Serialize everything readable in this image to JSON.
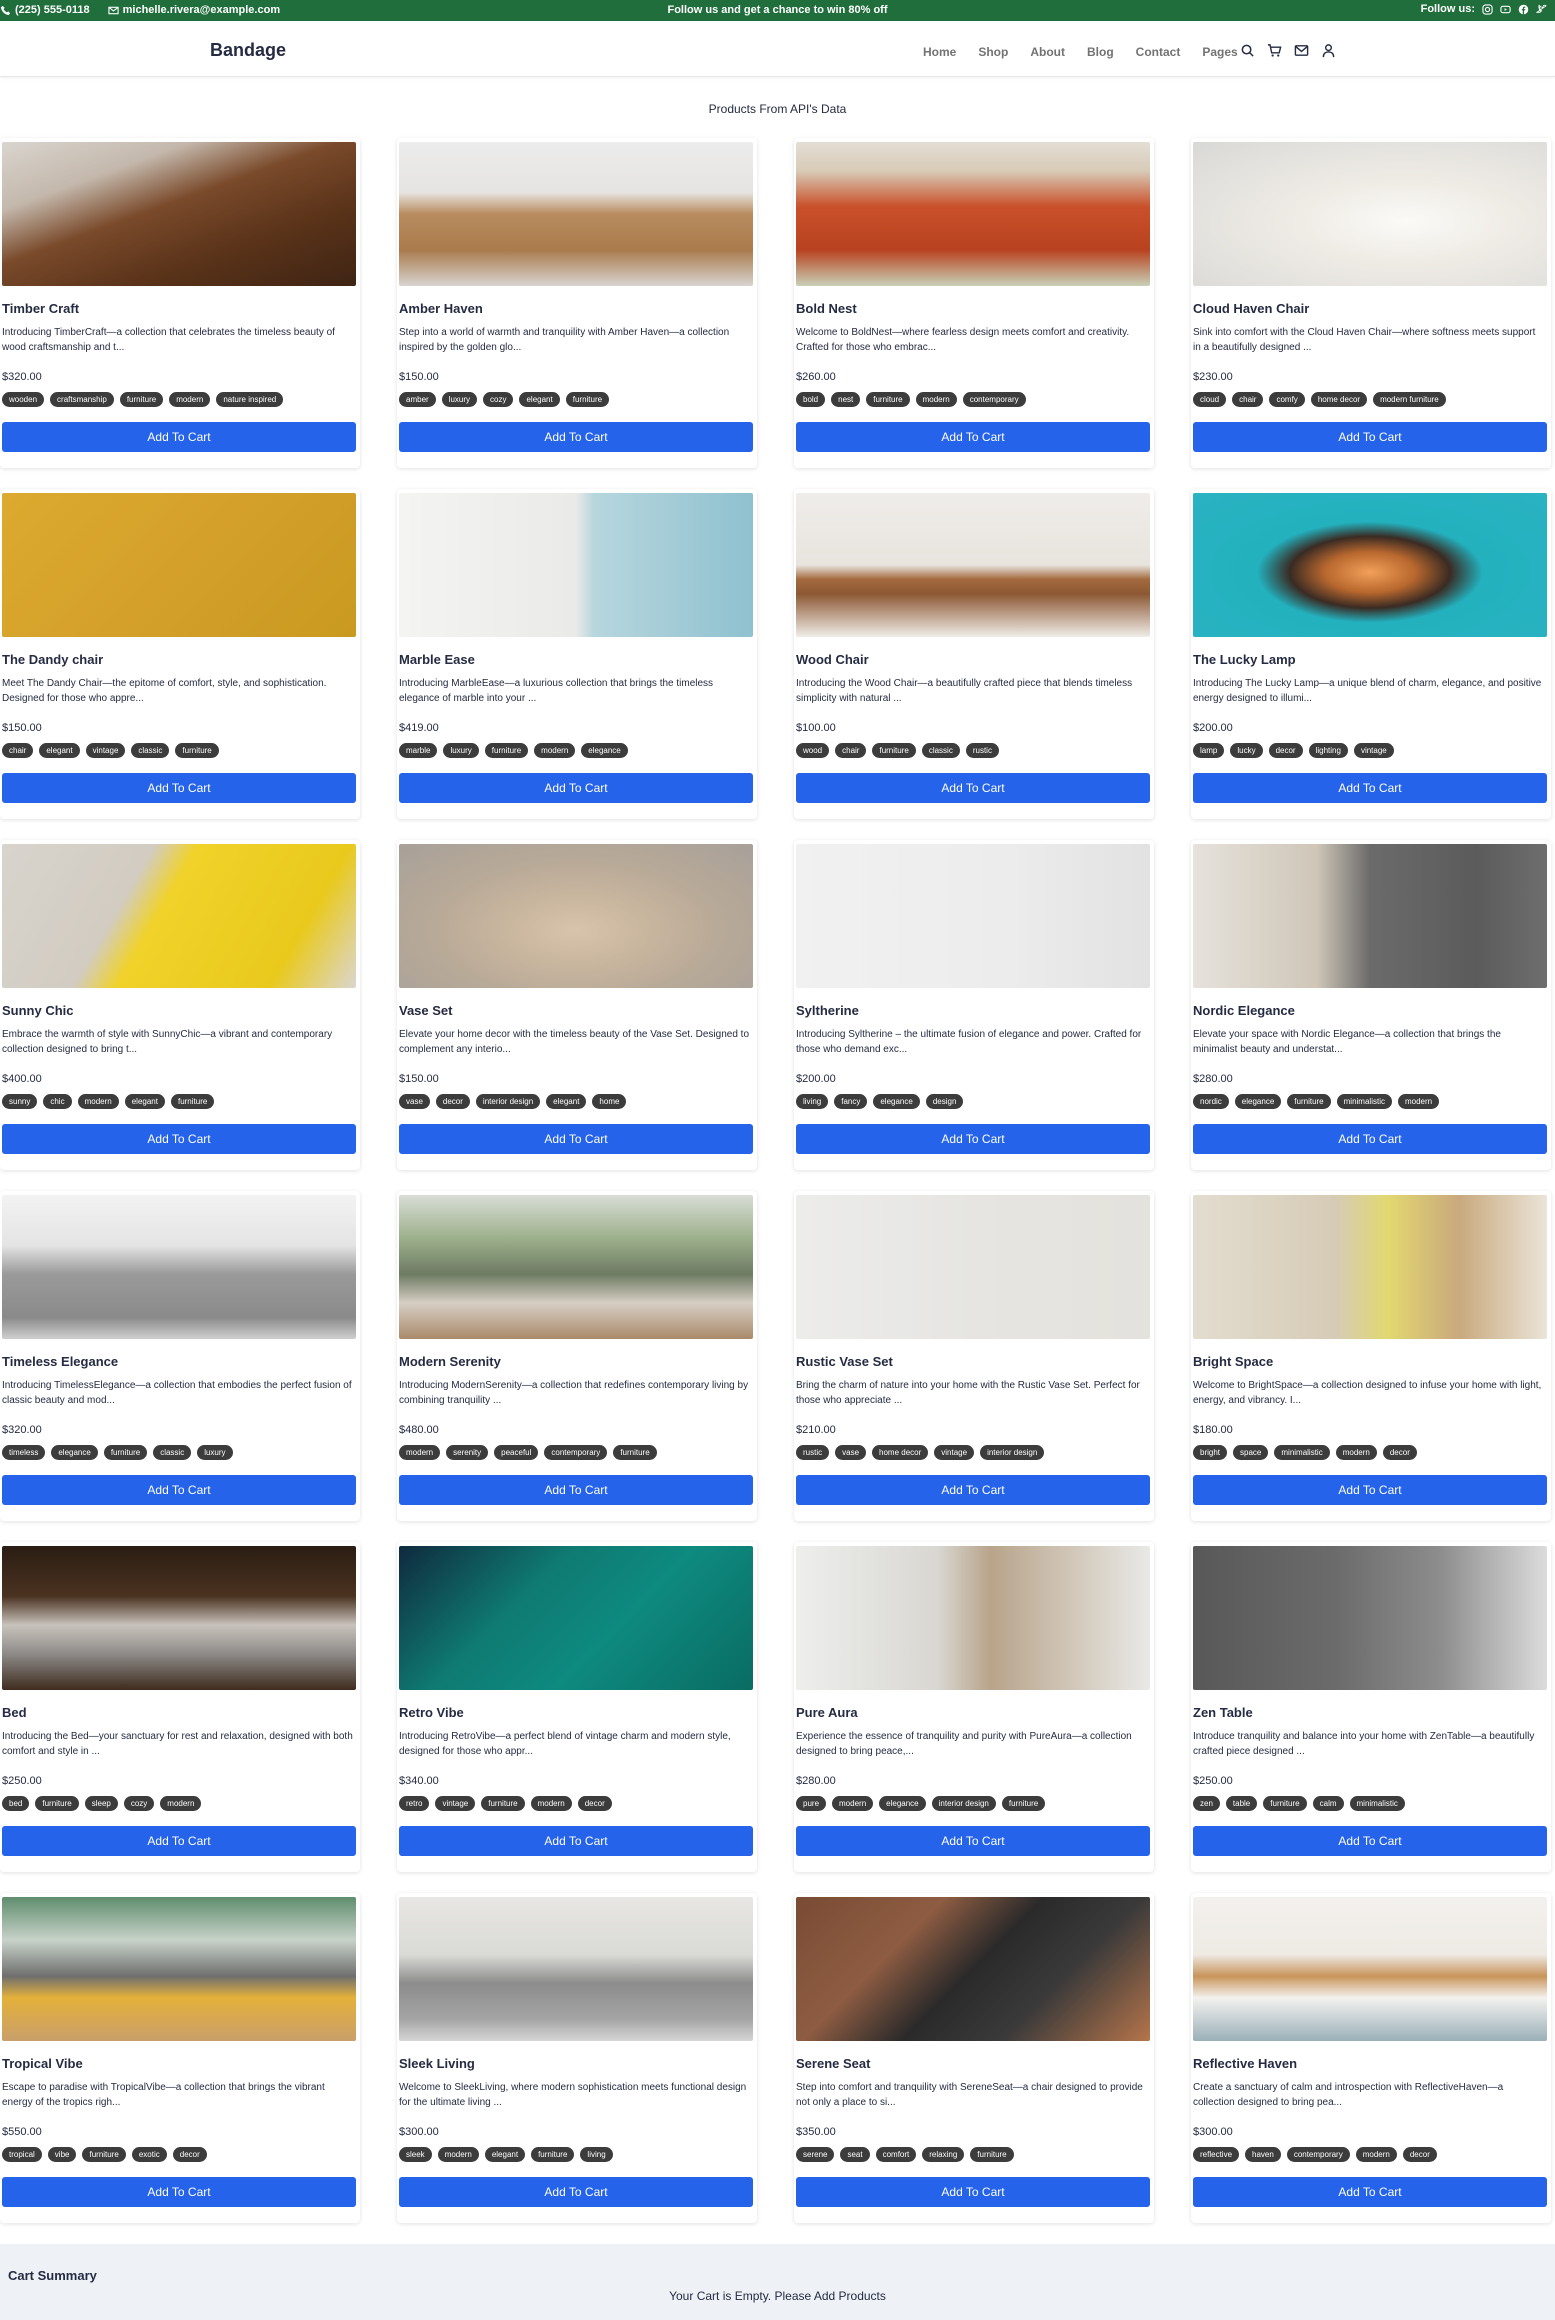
{
  "topbar": {
    "phone": "(225) 555-0118",
    "email": "michelle.rivera@example.com",
    "promo": "Follow us and get a chance to win 80% off",
    "follow_label": "Follow us:",
    "social_icons": [
      "instagram-icon",
      "youtube-icon",
      "facebook-icon",
      "twitter-icon"
    ]
  },
  "header": {
    "brand": "Bandage",
    "nav": [
      "Home",
      "Shop",
      "About",
      "Blog",
      "Contact",
      "Pages"
    ],
    "icons": [
      "search-icon",
      "cart-icon",
      "mail-icon",
      "user-icon"
    ]
  },
  "section_title": "Products From API's Data",
  "colors": {
    "topbar": "#1f6e3b",
    "button": "#2563eb",
    "tag": "#3c3c3c",
    "cart_bg": "#eef2f6"
  },
  "add_to_cart_label": "Add To Cart",
  "products": [
    {
      "title": "Timber Craft",
      "desc": "Introducing TimberCraft—a collection that celebrates the timeless beauty of wood craftsmanship and t...",
      "price": "$320.00",
      "tags": [
        "wooden",
        "craftsmanship",
        "furniture",
        "modern",
        "nature inspired"
      ]
    },
    {
      "title": "Amber Haven",
      "desc": "Step into a world of warmth and tranquility with Amber Haven—a collection inspired by the golden glo...",
      "price": "$150.00",
      "tags": [
        "amber",
        "luxury",
        "cozy",
        "elegant",
        "furniture"
      ]
    },
    {
      "title": "Bold Nest",
      "desc": "Welcome to BoldNest—where fearless design meets comfort and creativity. Crafted for those who embrac...",
      "price": "$260.00",
      "tags": [
        "bold",
        "nest",
        "furniture",
        "modern",
        "contemporary"
      ]
    },
    {
      "title": "Cloud Haven Chair",
      "desc": "Sink into comfort with the Cloud Haven Chair—where softness meets support in a beautifully designed ...",
      "price": "$230.00",
      "tags": [
        "cloud",
        "chair",
        "comfy",
        "home decor",
        "modern furniture"
      ]
    },
    {
      "title": "The Dandy chair",
      "desc": "Meet The Dandy Chair—the epitome of comfort, style, and sophistication. Designed for those who appre...",
      "price": "$150.00",
      "tags": [
        "chair",
        "elegant",
        "vintage",
        "classic",
        "furniture"
      ]
    },
    {
      "title": "Marble Ease",
      "desc": "Introducing MarbleEase—a luxurious collection that brings the timeless elegance of marble into your ...",
      "price": "$419.00",
      "tags": [
        "marble",
        "luxury",
        "furniture",
        "modern",
        "elegance"
      ]
    },
    {
      "title": "Wood Chair",
      "desc": "Introducing the Wood Chair—a beautifully crafted piece that blends timeless simplicity with natural ...",
      "price": "$100.00",
      "tags": [
        "wood",
        "chair",
        "furniture",
        "classic",
        "rustic"
      ]
    },
    {
      "title": "The Lucky Lamp",
      "desc": "Introducing The Lucky Lamp—a unique blend of charm, elegance, and positive energy designed to illumi...",
      "price": "$200.00",
      "tags": [
        "lamp",
        "lucky",
        "decor",
        "lighting",
        "vintage"
      ]
    },
    {
      "title": "Sunny Chic",
      "desc": "Embrace the warmth of style with SunnyChic—a vibrant and contemporary collection designed to bring t...",
      "price": "$400.00",
      "tags": [
        "sunny",
        "chic",
        "modern",
        "elegant",
        "furniture"
      ]
    },
    {
      "title": "Vase Set",
      "desc": "Elevate your home decor with the timeless beauty of the Vase Set. Designed to complement any interio...",
      "price": "$150.00",
      "tags": [
        "vase",
        "decor",
        "interior design",
        "elegant",
        "home"
      ]
    },
    {
      "title": "Syltherine",
      "desc": "Introducing Syltherine – the ultimate fusion of elegance and power. Crafted for those who demand exc...",
      "price": "$200.00",
      "tags": [
        "living",
        "fancy",
        "elegance",
        "design"
      ]
    },
    {
      "title": "Nordic Elegance",
      "desc": "Elevate your space with Nordic Elegance—a collection that brings the minimalist beauty and understat...",
      "price": "$280.00",
      "tags": [
        "nordic",
        "elegance",
        "furniture",
        "minimalistic",
        "modern"
      ]
    },
    {
      "title": "Timeless Elegance",
      "desc": "Introducing TimelessElegance—a collection that embodies the perfect fusion of classic beauty and mod...",
      "price": "$320.00",
      "tags": [
        "timeless",
        "elegance",
        "furniture",
        "classic",
        "luxury"
      ]
    },
    {
      "title": "Modern Serenity",
      "desc": "Introducing ModernSerenity—a collection that redefines contemporary living by combining tranquility ...",
      "price": "$480.00",
      "tags": [
        "modern",
        "serenity",
        "peaceful",
        "contemporary",
        "furniture"
      ]
    },
    {
      "title": "Rustic Vase Set",
      "desc": "Bring the charm of nature into your home with the Rustic Vase Set. Perfect for those who appreciate ...",
      "price": "$210.00",
      "tags": [
        "rustic",
        "vase",
        "home decor",
        "vintage",
        "interior design"
      ]
    },
    {
      "title": "Bright Space",
      "desc": "Welcome to BrightSpace—a collection designed to infuse your home with light, energy, and vibrancy. I...",
      "price": "$180.00",
      "tags": [
        "bright",
        "space",
        "minimalistic",
        "modern",
        "decor"
      ]
    },
    {
      "title": "Bed",
      "desc": "Introducing the Bed—your sanctuary for rest and relaxation, designed with both comfort and style in ...",
      "price": "$250.00",
      "tags": [
        "bed",
        "furniture",
        "sleep",
        "cozy",
        "modern"
      ]
    },
    {
      "title": "Retro Vibe",
      "desc": "Introducing RetroVibe—a perfect blend of vintage charm and modern style, designed for those who appr...",
      "price": "$340.00",
      "tags": [
        "retro",
        "vintage",
        "furniture",
        "modern",
        "decor"
      ]
    },
    {
      "title": "Pure Aura",
      "desc": "Experience the essence of tranquility and purity with PureAura—a collection designed to bring peace,...",
      "price": "$280.00",
      "tags": [
        "pure",
        "modern",
        "elegance",
        "interior design",
        "furniture"
      ]
    },
    {
      "title": "Zen Table",
      "desc": "Introduce tranquility and balance into your home with ZenTable—a beautifully crafted piece designed ...",
      "price": "$250.00",
      "tags": [
        "zen",
        "table",
        "furniture",
        "calm",
        "minimalistic"
      ]
    },
    {
      "title": "Tropical Vibe",
      "desc": "Escape to paradise with TropicalVibe—a collection that brings the vibrant energy of the tropics righ...",
      "price": "$550.00",
      "tags": [
        "tropical",
        "vibe",
        "furniture",
        "exotic",
        "decor"
      ]
    },
    {
      "title": "Sleek Living",
      "desc": "Welcome to SleekLiving, where modern sophistication meets functional design for the ultimate living ...",
      "price": "$300.00",
      "tags": [
        "sleek",
        "modern",
        "elegant",
        "furniture",
        "living"
      ]
    },
    {
      "title": "Serene Seat",
      "desc": "Step into comfort and tranquility with SereneSeat—a chair designed to provide not only a place to si...",
      "price": "$350.00",
      "tags": [
        "serene",
        "seat",
        "comfort",
        "relaxing",
        "furniture"
      ]
    },
    {
      "title": "Reflective Haven",
      "desc": "Create a sanctuary of calm and introspection with ReflectiveHaven—a collection designed to bring pea...",
      "price": "$300.00",
      "tags": [
        "reflective",
        "haven",
        "contemporary",
        "modern",
        "decor"
      ]
    }
  ],
  "cart": {
    "title": "Cart Summary",
    "empty_message": "Your Cart is Empty. Please Add Products"
  }
}
